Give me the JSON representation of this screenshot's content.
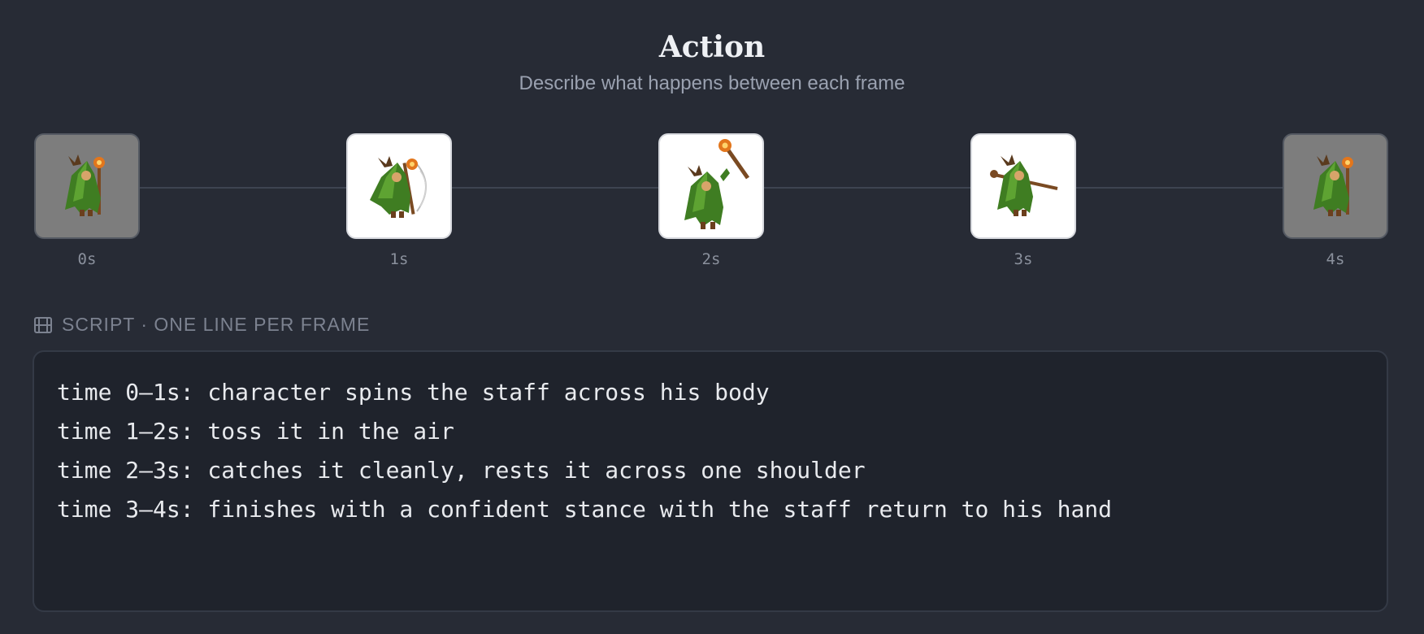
{
  "header": {
    "title": "Action",
    "subtitle": "Describe what happens between each frame"
  },
  "frames": [
    {
      "time": "0s",
      "pose": "idle",
      "style": "dim"
    },
    {
      "time": "1s",
      "pose": "spin",
      "style": "light"
    },
    {
      "time": "2s",
      "pose": "toss",
      "style": "light"
    },
    {
      "time": "3s",
      "pose": "shoulder",
      "style": "light"
    },
    {
      "time": "4s",
      "pose": "idle",
      "style": "dim"
    }
  ],
  "script": {
    "label": "SCRIPT · ONE LINE PER FRAME",
    "icon": "film-icon",
    "lines": [
      "time 0–1s: character spins the staff across his body",
      "time 1–2s: toss it in the air",
      "time 2–3s: catches it cleanly, rests it across one shoulder",
      "time 3–4s: finishes with a confident stance with the staff return to his hand"
    ]
  }
}
